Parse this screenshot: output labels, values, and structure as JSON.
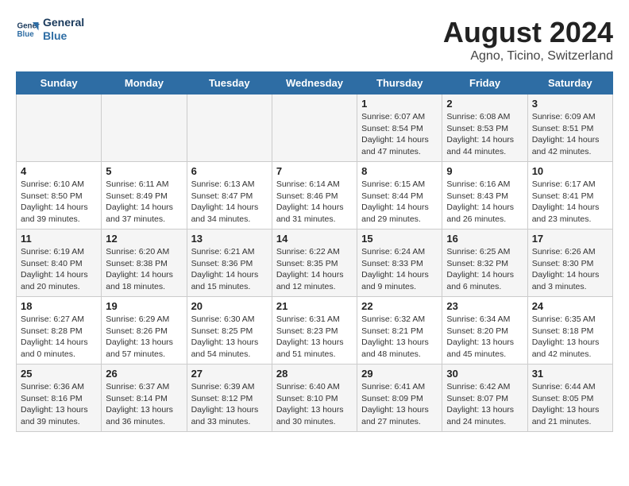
{
  "header": {
    "logo_line1": "General",
    "logo_line2": "Blue",
    "month_year": "August 2024",
    "location": "Agno, Ticino, Switzerland"
  },
  "days_of_week": [
    "Sunday",
    "Monday",
    "Tuesday",
    "Wednesday",
    "Thursday",
    "Friday",
    "Saturday"
  ],
  "weeks": [
    [
      {
        "day": "",
        "info": ""
      },
      {
        "day": "",
        "info": ""
      },
      {
        "day": "",
        "info": ""
      },
      {
        "day": "",
        "info": ""
      },
      {
        "day": "1",
        "info": "Sunrise: 6:07 AM\nSunset: 8:54 PM\nDaylight: 14 hours\nand 47 minutes."
      },
      {
        "day": "2",
        "info": "Sunrise: 6:08 AM\nSunset: 8:53 PM\nDaylight: 14 hours\nand 44 minutes."
      },
      {
        "day": "3",
        "info": "Sunrise: 6:09 AM\nSunset: 8:51 PM\nDaylight: 14 hours\nand 42 minutes."
      }
    ],
    [
      {
        "day": "4",
        "info": "Sunrise: 6:10 AM\nSunset: 8:50 PM\nDaylight: 14 hours\nand 39 minutes."
      },
      {
        "day": "5",
        "info": "Sunrise: 6:11 AM\nSunset: 8:49 PM\nDaylight: 14 hours\nand 37 minutes."
      },
      {
        "day": "6",
        "info": "Sunrise: 6:13 AM\nSunset: 8:47 PM\nDaylight: 14 hours\nand 34 minutes."
      },
      {
        "day": "7",
        "info": "Sunrise: 6:14 AM\nSunset: 8:46 PM\nDaylight: 14 hours\nand 31 minutes."
      },
      {
        "day": "8",
        "info": "Sunrise: 6:15 AM\nSunset: 8:44 PM\nDaylight: 14 hours\nand 29 minutes."
      },
      {
        "day": "9",
        "info": "Sunrise: 6:16 AM\nSunset: 8:43 PM\nDaylight: 14 hours\nand 26 minutes."
      },
      {
        "day": "10",
        "info": "Sunrise: 6:17 AM\nSunset: 8:41 PM\nDaylight: 14 hours\nand 23 minutes."
      }
    ],
    [
      {
        "day": "11",
        "info": "Sunrise: 6:19 AM\nSunset: 8:40 PM\nDaylight: 14 hours\nand 20 minutes."
      },
      {
        "day": "12",
        "info": "Sunrise: 6:20 AM\nSunset: 8:38 PM\nDaylight: 14 hours\nand 18 minutes."
      },
      {
        "day": "13",
        "info": "Sunrise: 6:21 AM\nSunset: 8:36 PM\nDaylight: 14 hours\nand 15 minutes."
      },
      {
        "day": "14",
        "info": "Sunrise: 6:22 AM\nSunset: 8:35 PM\nDaylight: 14 hours\nand 12 minutes."
      },
      {
        "day": "15",
        "info": "Sunrise: 6:24 AM\nSunset: 8:33 PM\nDaylight: 14 hours\nand 9 minutes."
      },
      {
        "day": "16",
        "info": "Sunrise: 6:25 AM\nSunset: 8:32 PM\nDaylight: 14 hours\nand 6 minutes."
      },
      {
        "day": "17",
        "info": "Sunrise: 6:26 AM\nSunset: 8:30 PM\nDaylight: 14 hours\nand 3 minutes."
      }
    ],
    [
      {
        "day": "18",
        "info": "Sunrise: 6:27 AM\nSunset: 8:28 PM\nDaylight: 14 hours\nand 0 minutes."
      },
      {
        "day": "19",
        "info": "Sunrise: 6:29 AM\nSunset: 8:26 PM\nDaylight: 13 hours\nand 57 minutes."
      },
      {
        "day": "20",
        "info": "Sunrise: 6:30 AM\nSunset: 8:25 PM\nDaylight: 13 hours\nand 54 minutes."
      },
      {
        "day": "21",
        "info": "Sunrise: 6:31 AM\nSunset: 8:23 PM\nDaylight: 13 hours\nand 51 minutes."
      },
      {
        "day": "22",
        "info": "Sunrise: 6:32 AM\nSunset: 8:21 PM\nDaylight: 13 hours\nand 48 minutes."
      },
      {
        "day": "23",
        "info": "Sunrise: 6:34 AM\nSunset: 8:20 PM\nDaylight: 13 hours\nand 45 minutes."
      },
      {
        "day": "24",
        "info": "Sunrise: 6:35 AM\nSunset: 8:18 PM\nDaylight: 13 hours\nand 42 minutes."
      }
    ],
    [
      {
        "day": "25",
        "info": "Sunrise: 6:36 AM\nSunset: 8:16 PM\nDaylight: 13 hours\nand 39 minutes."
      },
      {
        "day": "26",
        "info": "Sunrise: 6:37 AM\nSunset: 8:14 PM\nDaylight: 13 hours\nand 36 minutes."
      },
      {
        "day": "27",
        "info": "Sunrise: 6:39 AM\nSunset: 8:12 PM\nDaylight: 13 hours\nand 33 minutes."
      },
      {
        "day": "28",
        "info": "Sunrise: 6:40 AM\nSunset: 8:10 PM\nDaylight: 13 hours\nand 30 minutes."
      },
      {
        "day": "29",
        "info": "Sunrise: 6:41 AM\nSunset: 8:09 PM\nDaylight: 13 hours\nand 27 minutes."
      },
      {
        "day": "30",
        "info": "Sunrise: 6:42 AM\nSunset: 8:07 PM\nDaylight: 13 hours\nand 24 minutes."
      },
      {
        "day": "31",
        "info": "Sunrise: 6:44 AM\nSunset: 8:05 PM\nDaylight: 13 hours\nand 21 minutes."
      }
    ]
  ]
}
